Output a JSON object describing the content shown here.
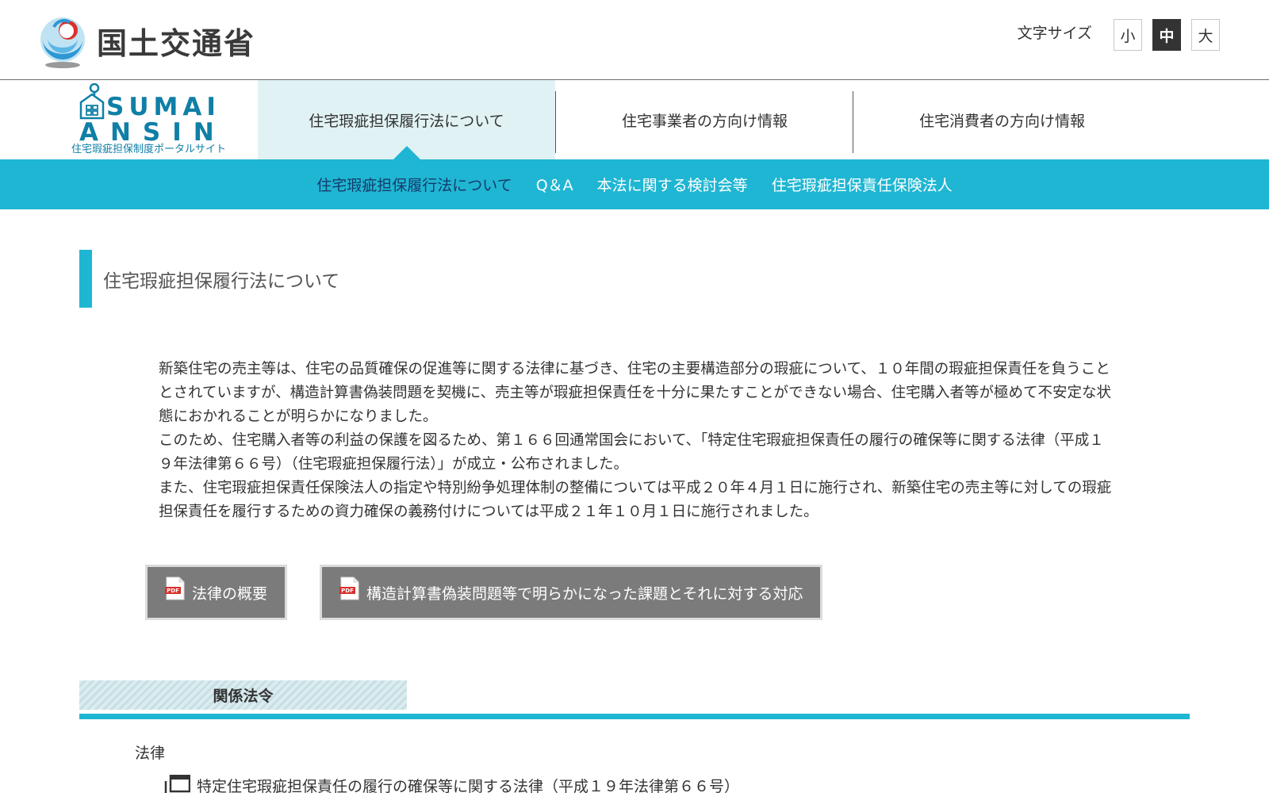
{
  "header": {
    "ministry_name": "国土交通省",
    "font_size": {
      "label": "文字サイズ",
      "options": [
        "小",
        "中",
        "大"
      ],
      "selected": "中"
    }
  },
  "site_logo": {
    "line1": "SUMAI",
    "line2": "ANSIN",
    "subtitle": "住宅瑕疵担保制度ポータルサイト"
  },
  "main_nav": {
    "tabs": [
      {
        "label": "住宅瑕疵担保履行法について",
        "active": true
      },
      {
        "label": "住宅事業者の方向け情報",
        "active": false
      },
      {
        "label": "住宅消費者の方向け情報",
        "active": false
      }
    ]
  },
  "sub_nav": {
    "items": [
      {
        "label": "住宅瑕疵担保履行法について",
        "active": true
      },
      {
        "label": "Q＆A",
        "active": false
      },
      {
        "label": "本法に関する検討会等",
        "active": false
      },
      {
        "label": "住宅瑕疵担保責任保険法人",
        "active": false
      }
    ]
  },
  "page": {
    "title": "住宅瑕疵担保履行法について",
    "intro": [
      "新築住宅の売主等は、住宅の品質確保の促進等に関する法律に基づき、住宅の主要構造部分の瑕疵について、１０年間の瑕疵担保責任を負うこととされていますが、構造計算書偽装問題を契機に、売主等が瑕疵担保責任を十分に果たすことができない場合、住宅購入者等が極めて不安定な状態におかれることが明らかになりました。",
      "このため、住宅購入者等の利益の保護を図るため、第１６６回通常国会において、「特定住宅瑕疵担保責任の履行の確保等に関する法律（平成１９年法律第６６号）（住宅瑕疵担保履行法）」が成立・公布されました。",
      "また、住宅瑕疵担保責任保険法人の指定や特別紛争処理体制の整備については平成２０年４月１日に施行され、新築住宅の売主等に対しての瑕疵担保責任を履行するための資力確保の義務付けについては平成２１年１０月１日に施行されました。"
    ],
    "pdf_buttons": [
      {
        "label": "法律の概要",
        "icon": "pdf-icon"
      },
      {
        "label": "構造計算書偽装問題等で明らかになった課題とそれに対する対応",
        "icon": "pdf-icon"
      }
    ],
    "section": {
      "heading": "関係法令",
      "category": "法律",
      "items": [
        {
          "label": "特定住宅瑕疵担保責任の履行の確保等に関する法律（平成１９年法律第６６号）",
          "icon": "new-window-icon"
        }
      ]
    }
  },
  "colors": {
    "accent": "#1fb6d3",
    "active_tab_bg": "#e1f2f4",
    "subnav_active_text": "#163a6b",
    "button_gray": "#7b7b7b",
    "logo_blue": "#0f7fa6"
  }
}
